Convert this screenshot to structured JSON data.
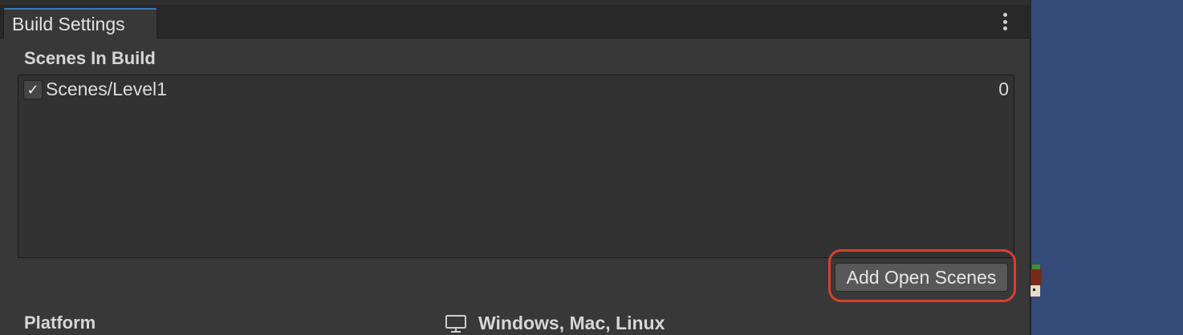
{
  "window": {
    "tab_title": "Build Settings"
  },
  "scenes": {
    "section_title": "Scenes In Build",
    "items": [
      {
        "name": "Scenes/Level1",
        "checked": true,
        "checkmark": "✓",
        "index": "0"
      }
    ],
    "add_open_scenes_label": "Add Open Scenes"
  },
  "platform": {
    "section_title": "Platform",
    "selected_name": "Windows, Mac, Linux",
    "icon": "monitor-icon"
  },
  "colors": {
    "highlight": "#d8402e",
    "tab_accent": "#3a79bb",
    "scene_view_background": "#344a78"
  }
}
